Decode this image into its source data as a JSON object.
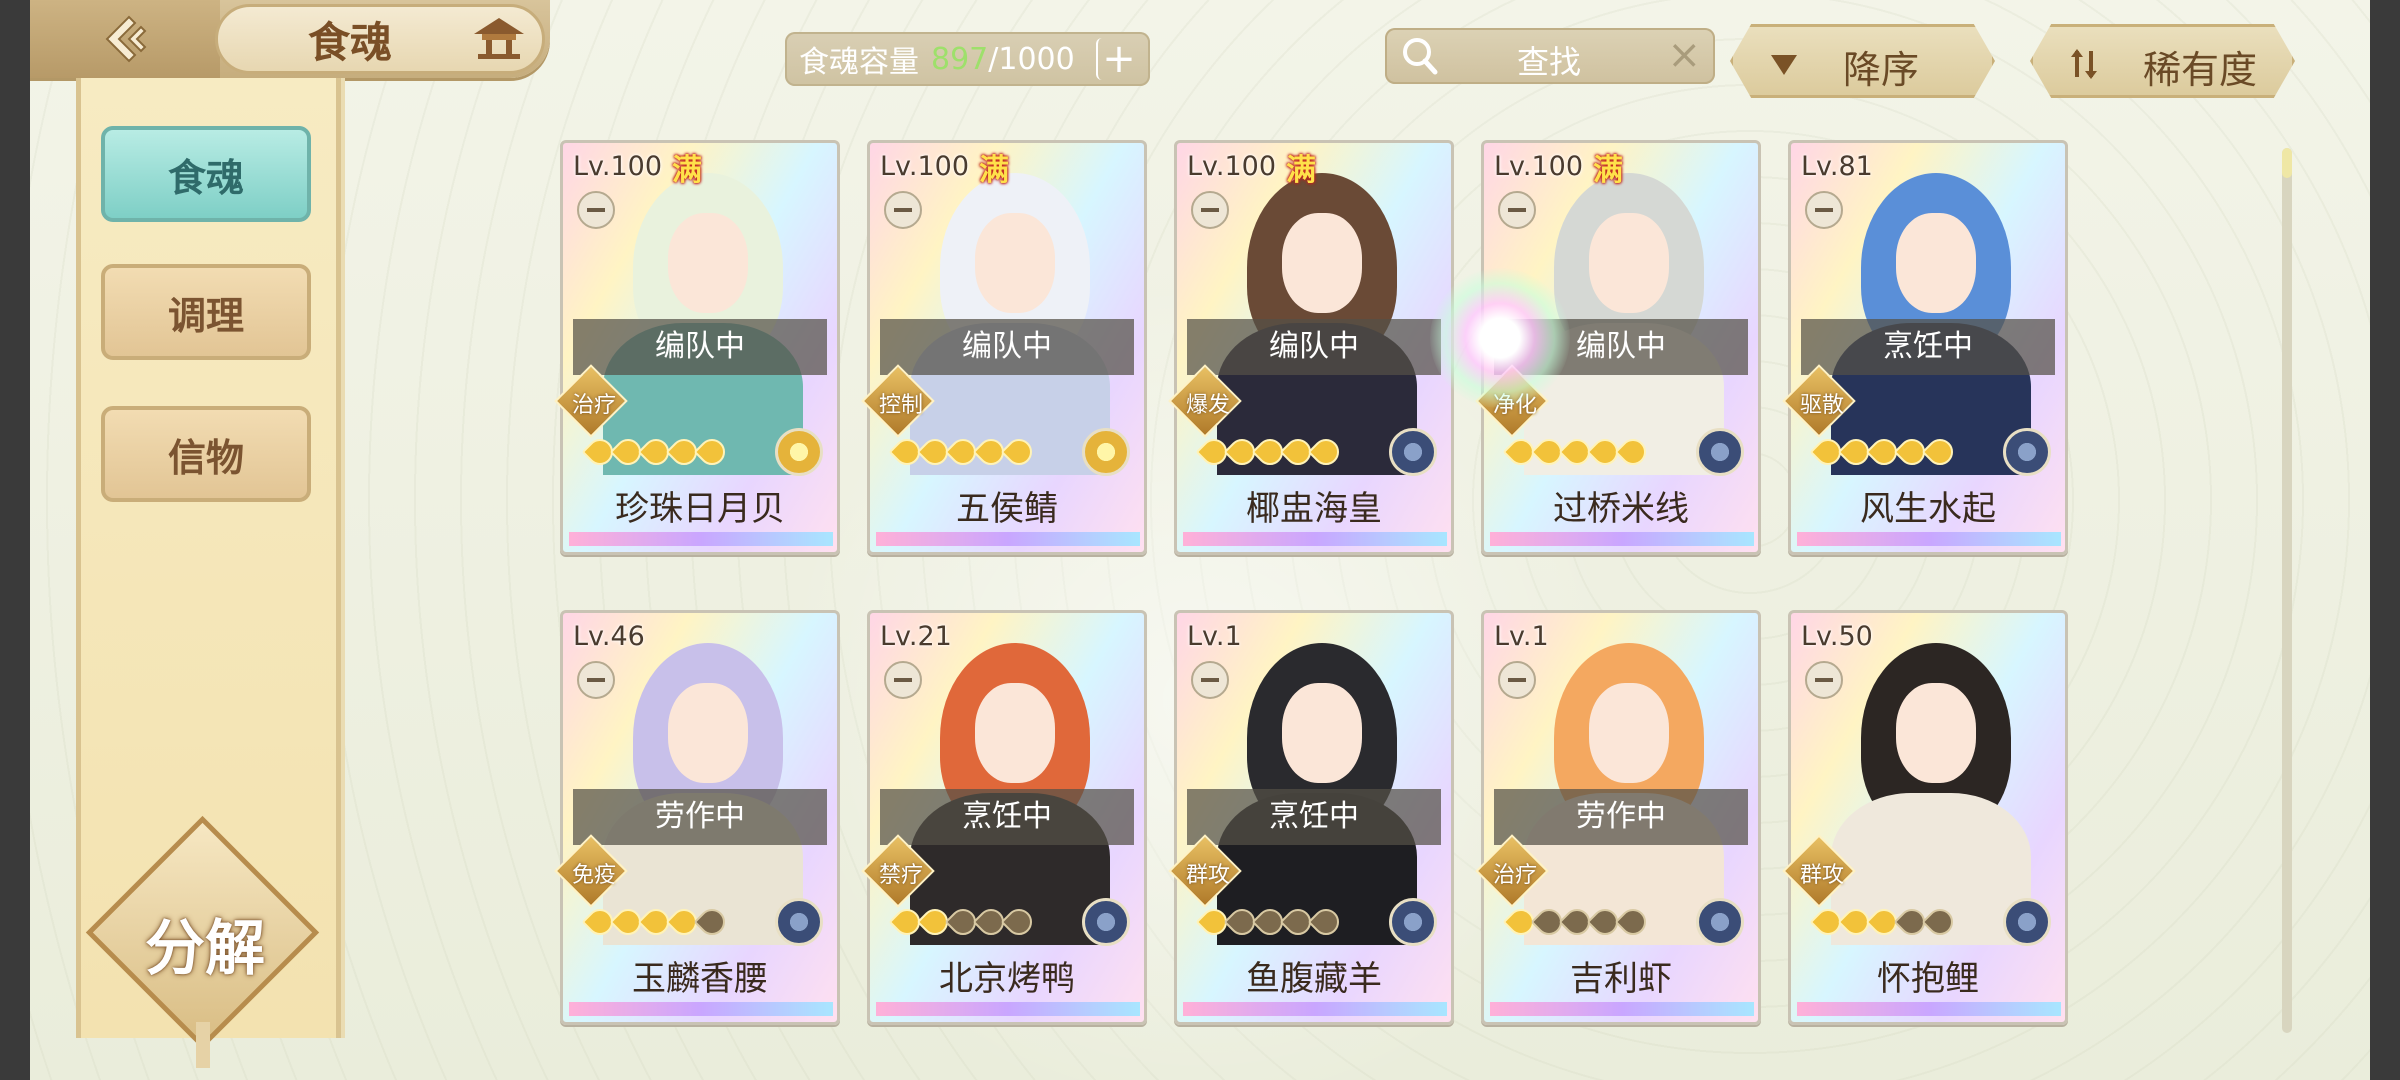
{
  "header": {
    "title": "食魂",
    "back_icon": "back-arrow-icon",
    "home_icon": "pavilion-icon",
    "capacity_label": "食魂容量",
    "capacity_current": "897",
    "capacity_max": "/1000",
    "capacity_add": "+",
    "search_placeholder": "查找",
    "search_clear": "×",
    "sort_label": "降序",
    "filter_label": "稀有度"
  },
  "sidebar": {
    "items": [
      {
        "label": "食魂",
        "active": true
      },
      {
        "label": "调理",
        "active": false
      },
      {
        "label": "信物",
        "active": false
      }
    ],
    "decompose_label": "分解"
  },
  "cards": [
    {
      "level": "Lv.100",
      "max": "满",
      "status": "编队中",
      "role": "治疗",
      "stars_on": 5,
      "element": "gold",
      "name": "珍珠日月贝",
      "hair": "#e9f2dd",
      "body": "#6fb8b0"
    },
    {
      "level": "Lv.100",
      "max": "满",
      "status": "编队中",
      "role": "控制",
      "stars_on": 5,
      "element": "gold",
      "name": "五侯鲭",
      "hair": "#eef1f7",
      "body": "#c7d0e8"
    },
    {
      "level": "Lv.100",
      "max": "满",
      "status": "编队中",
      "role": "爆发",
      "stars_on": 5,
      "element": "blue",
      "name": "椰盅海皇",
      "hair": "#6a4a36",
      "body": "#2b2a3a"
    },
    {
      "level": "Lv.100",
      "max": "满",
      "status": "编队中",
      "role": "净化",
      "stars_on": 5,
      "element": "blue",
      "name": "过桥米线",
      "hair": "#d5d8d4",
      "body": "#f1eee4"
    },
    {
      "level": "Lv.81",
      "max": "",
      "status": "烹饪中",
      "role": "驱散",
      "stars_on": 5,
      "element": "blue",
      "name": "风生水起",
      "hair": "#5a8fd8",
      "body": "#27345a"
    },
    {
      "level": "Lv.46",
      "max": "",
      "status": "劳作中",
      "role": "免疫",
      "stars_on": 4,
      "element": "blue",
      "name": "玉麟香腰",
      "hair": "#c8c0ea",
      "body": "#eae4d4"
    },
    {
      "level": "Lv.21",
      "max": "",
      "status": "烹饪中",
      "role": "禁疗",
      "stars_on": 2,
      "element": "blue",
      "name": "北京烤鸭",
      "hair": "#e0683a",
      "body": "#2e2a2a"
    },
    {
      "level": "Lv.1",
      "max": "",
      "status": "烹饪中",
      "role": "群攻",
      "stars_on": 1,
      "element": "blue",
      "name": "鱼腹藏羊",
      "hair": "#2a2a2e",
      "body": "#1e1e22"
    },
    {
      "level": "Lv.1",
      "max": "",
      "status": "劳作中",
      "role": "治疗",
      "stars_on": 1,
      "element": "blue",
      "name": "吉利虾",
      "hair": "#f4a860",
      "body": "#f3e6d6"
    },
    {
      "level": "Lv.50",
      "max": "",
      "status": "",
      "role": "群攻",
      "stars_on": 3,
      "element": "blue",
      "name": "怀抱鲤",
      "hair": "#2c2623",
      "body": "#efe8dc"
    }
  ]
}
